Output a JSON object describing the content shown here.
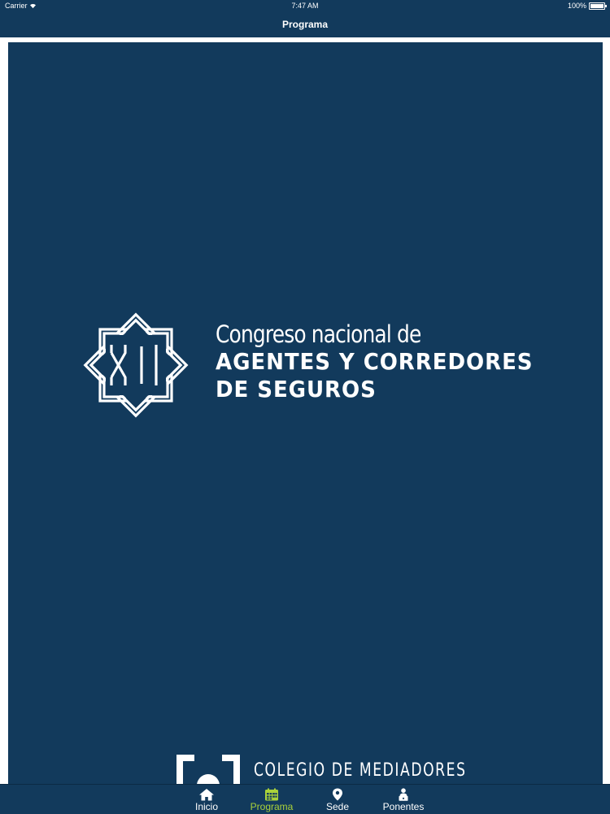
{
  "status_bar": {
    "carrier": "Carrier",
    "time": "7:47 AM",
    "battery": "100%",
    "battery_level": 1.0
  },
  "nav": {
    "title": "Programa"
  },
  "poster": {
    "emblem_letters": "XI",
    "line1": "Congreso nacional de",
    "line2": "AGENTES Y CORREDORES",
    "line3": "DE SEGUROS",
    "footer_org": "COLEGIO DE MEDIADORES"
  },
  "tabs": [
    {
      "label": "Inicio",
      "icon": "home-icon",
      "active": false
    },
    {
      "label": "Programa",
      "icon": "calendar-icon",
      "active": true
    },
    {
      "label": "Sede",
      "icon": "map-pin-icon",
      "active": false
    },
    {
      "label": "Ponentes",
      "icon": "speaker-icon",
      "active": false
    }
  ],
  "colors": {
    "bar_background": "#123a5c",
    "poster_background": "#123a5c",
    "active_tab": "#a9d13a",
    "text": "#ffffff"
  }
}
